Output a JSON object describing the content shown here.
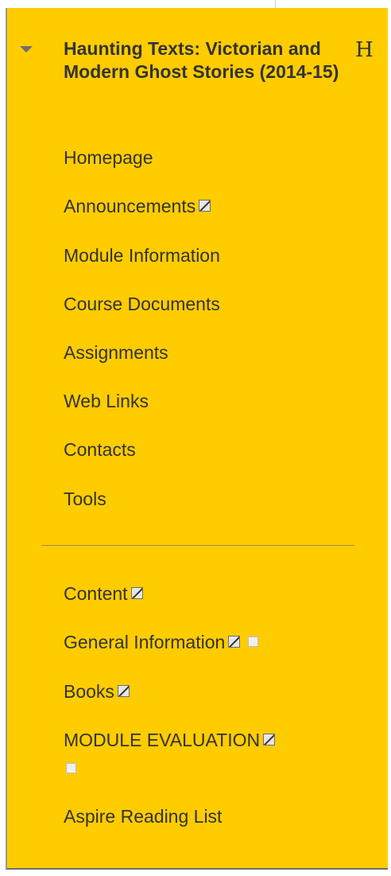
{
  "course": {
    "title": "Haunting Texts: Victorian and Modern Ghost Stories (2014-15)",
    "icon_letter": "H"
  },
  "menu": {
    "items": [
      {
        "label": "Homepage"
      },
      {
        "label": "Announcements"
      },
      {
        "label": "Module Information"
      },
      {
        "label": "Course Documents"
      },
      {
        "label": "Assignments"
      },
      {
        "label": "Web Links"
      },
      {
        "label": "Contacts"
      },
      {
        "label": "Tools"
      }
    ],
    "custom_items": [
      {
        "label": "Content"
      },
      {
        "label": "General Information"
      },
      {
        "label": "Books"
      },
      {
        "label": "MODULE EVALUATION"
      },
      {
        "label": "Aspire Reading List"
      }
    ]
  },
  "colors": {
    "panel_background": "#ffcc00",
    "text": "#333333",
    "divider": "#9a8b4a"
  },
  "icons": {
    "collapse": "triangle-down-icon",
    "hidden_from_students": "hidden-icon",
    "link_item": "link-icon"
  }
}
